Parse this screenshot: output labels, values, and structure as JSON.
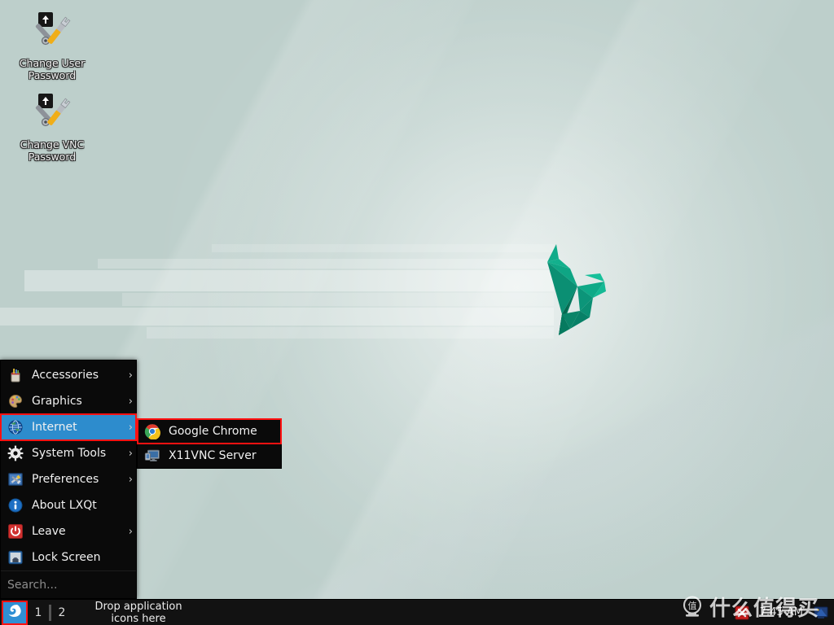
{
  "desktop": {
    "background_color": "#bdcfcb",
    "wallpaper_accent": "#0fa37f",
    "icons": [
      {
        "label": "Change User\nPassword",
        "icon": "wrench-screwdriver-icon"
      },
      {
        "label": "Change VNC\nPassword",
        "icon": "wrench-screwdriver-icon"
      }
    ]
  },
  "menu": {
    "highlight_color": "#2d8ccd",
    "selection_box_color": "#ff1111",
    "items": [
      {
        "label": "Accessories",
        "icon": "accessories-icon",
        "has_submenu": true,
        "arrow": "›",
        "selected": false
      },
      {
        "label": "Graphics",
        "icon": "graphics-icon",
        "has_submenu": true,
        "arrow": "›",
        "selected": false
      },
      {
        "label": "Internet",
        "icon": "globe-icon",
        "has_submenu": true,
        "arrow": "›",
        "selected": true
      },
      {
        "label": "System Tools",
        "icon": "gear-icon",
        "has_submenu": true,
        "arrow": "›",
        "selected": false
      },
      {
        "label": "Preferences",
        "icon": "preferences-icon",
        "has_submenu": true,
        "arrow": "›",
        "selected": false
      },
      {
        "label": "About LXQt",
        "icon": "info-icon",
        "has_submenu": false,
        "arrow": "",
        "selected": false
      },
      {
        "label": "Leave",
        "icon": "power-icon",
        "has_submenu": true,
        "arrow": "›",
        "selected": false
      },
      {
        "label": "Lock Screen",
        "icon": "lock-screen-icon",
        "has_submenu": false,
        "arrow": "",
        "selected": false
      }
    ],
    "search_placeholder": "Search..."
  },
  "submenu": {
    "items": [
      {
        "label": "Google Chrome",
        "icon": "chrome-icon",
        "highlighted": true
      },
      {
        "label": "X11VNC Server",
        "icon": "monitor-icon",
        "highlighted": false
      }
    ]
  },
  "panel": {
    "start_button": {
      "icon": "lxqt-bird-icon",
      "color": "#2f8fd4"
    },
    "desktops": [
      "1",
      "2"
    ],
    "quicklaunch_hint": "Drop application\nicons here",
    "tray": [
      {
        "icon": "error-x-icon",
        "color": "#cc1e1e"
      },
      {
        "icon": "network-icon",
        "color": "#2a57a8"
      }
    ],
    "clock": "7:45 AM"
  },
  "watermark": {
    "logo_text": "值",
    "text": "什么值得买"
  }
}
